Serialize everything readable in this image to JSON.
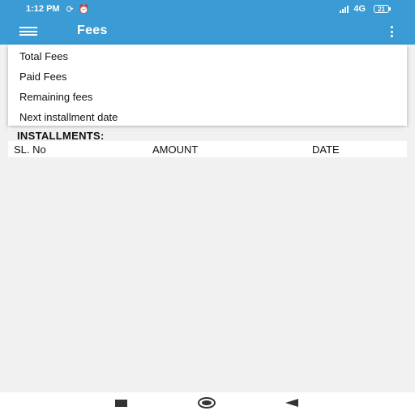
{
  "status_bar": {
    "time": "1:12 PM",
    "network": "4G",
    "battery": "21"
  },
  "app_bar": {
    "title": "Fees"
  },
  "menu": {
    "items": [
      {
        "label": "Total Fees"
      },
      {
        "label": "Paid Fees"
      },
      {
        "label": "Remaining fees"
      },
      {
        "label": "Next installment date"
      }
    ]
  },
  "installments": {
    "title": "INSTALLMENTS:",
    "columns": [
      "SL. No",
      "AMOUNT",
      "DATE"
    ]
  },
  "colors": {
    "primary": "#3b9bd4",
    "background": "#f1f1f1"
  }
}
